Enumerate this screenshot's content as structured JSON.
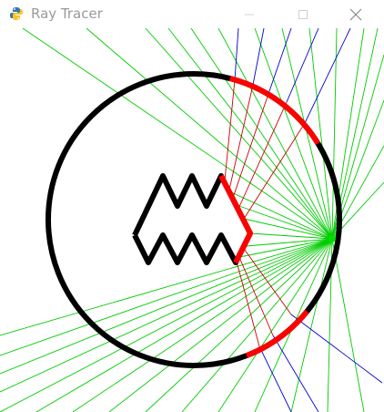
{
  "window": {
    "title": "Ray Tracer",
    "app_icon": "python-snake-icon",
    "controls": [
      "minimize-icon",
      "maximize-icon",
      "close-icon"
    ]
  },
  "scene": {
    "colors": {
      "background": "#ffffff",
      "mirror": "#000000",
      "mirror_hit": "#ff0000",
      "ray_primary": "#00cc00",
      "ray_reflected": "#cc0000",
      "ray_escaped": "#0000cc"
    }
  }
}
